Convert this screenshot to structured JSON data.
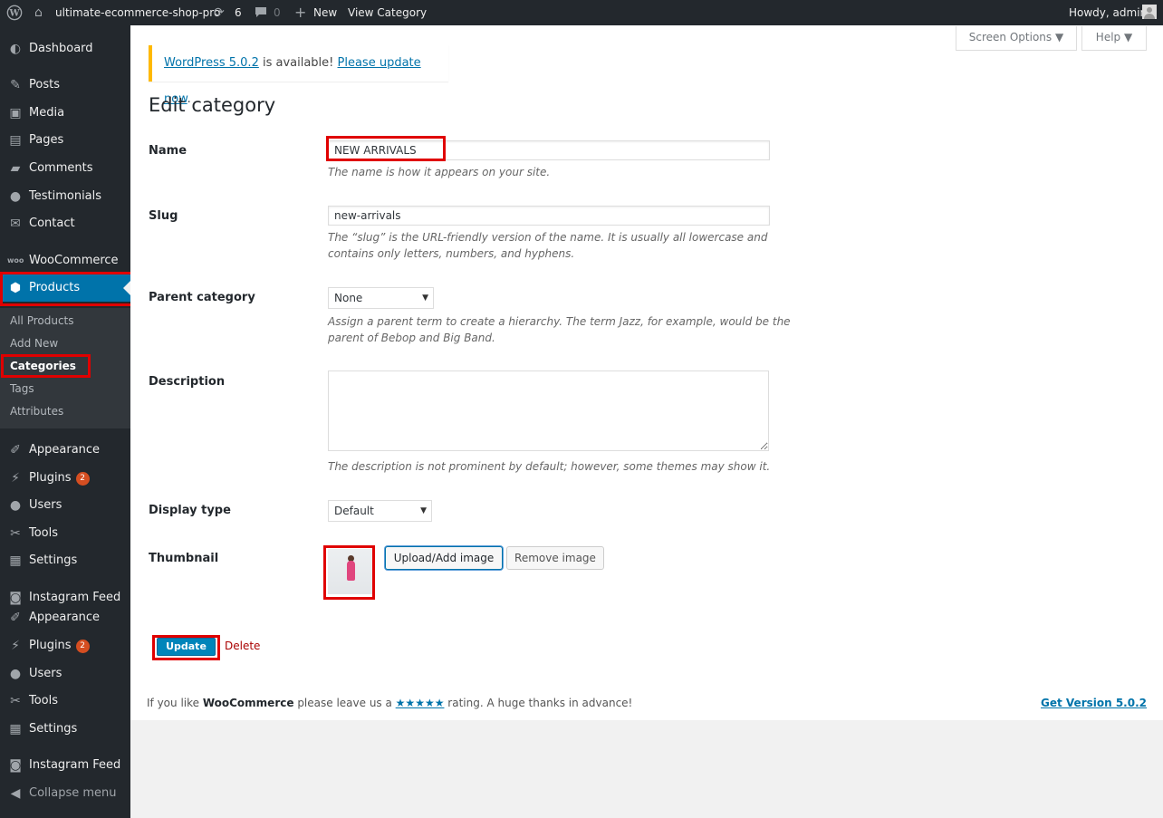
{
  "admin_bar": {
    "wp_logo": "wordpress-logo-icon",
    "site_name": "ultimate-ecommerce-shop-pro",
    "updates_count": "6",
    "comments_count": "0",
    "new_label": "New",
    "view_label": "View Category",
    "howdy": "Howdy, admin"
  },
  "sidebar": {
    "dashboard": "Dashboard",
    "posts": "Posts",
    "media": "Media",
    "pages": "Pages",
    "comments": "Comments",
    "testimonials": "Testimonials",
    "contact": "Contact",
    "woocommerce": "WooCommerce",
    "products": "Products",
    "submenu": {
      "all_products": "All Products",
      "add_new": "Add New",
      "categories": "Categories",
      "tags": "Tags",
      "attributes": "Attributes"
    },
    "appearance": "Appearance",
    "plugins": "Plugins",
    "plugins_badge": "2",
    "users": "Users",
    "tools": "Tools",
    "settings": "Settings",
    "instagram_feed": "Instagram Feed",
    "appearance2": "Appearance",
    "plugins2": "Plugins",
    "plugins2_badge": "2",
    "users2": "Users",
    "tools2": "Tools",
    "settings2": "Settings",
    "instagram_feed2": "Instagram Feed",
    "collapse": "Collapse menu"
  },
  "screen_options": {
    "label": "Screen Options ▼"
  },
  "help": {
    "label": "Help ▼"
  },
  "notice": {
    "version_link": "WordPress 5.0.2",
    "middle": " is available! ",
    "update_link": "Please update now",
    "end": "."
  },
  "page_title": "Edit category",
  "form": {
    "name_label": "Name",
    "name_value": "NEW ARRIVALS",
    "name_hint": "The name is how it appears on your site.",
    "slug_label": "Slug",
    "slug_value": "new-arrivals",
    "slug_hint": "The “slug” is the URL-friendly version of the name. It is usually all lowercase and contains only letters, numbers, and hyphens.",
    "parent_label": "Parent category",
    "parent_value": "None",
    "parent_hint": "Assign a parent term to create a hierarchy. The term Jazz, for example, would be the parent of Bebop and Big Band.",
    "description_label": "Description",
    "description_value": "",
    "description_hint": "The description is not prominent by default; however, some themes may show it.",
    "display_label": "Display type",
    "display_value": "Default",
    "thumbnail_label": "Thumbnail",
    "upload_button": "Upload/Add image",
    "remove_button": "Remove image",
    "update_button": "Update",
    "delete_link": "Delete"
  },
  "footer": {
    "left_before": "If you like ",
    "left_brand": "WooCommerce",
    "left_mid": " please leave us a ",
    "stars": "★★★★★",
    "left_after": " rating. A huge thanks in advance!",
    "version_link": "Get Version 5.0.2"
  },
  "colors": {
    "admin_blue": "#0073aa",
    "highlight_red": "#e00000",
    "sidebar_bg": "#23282d",
    "notice_yellow": "#ffb900"
  }
}
